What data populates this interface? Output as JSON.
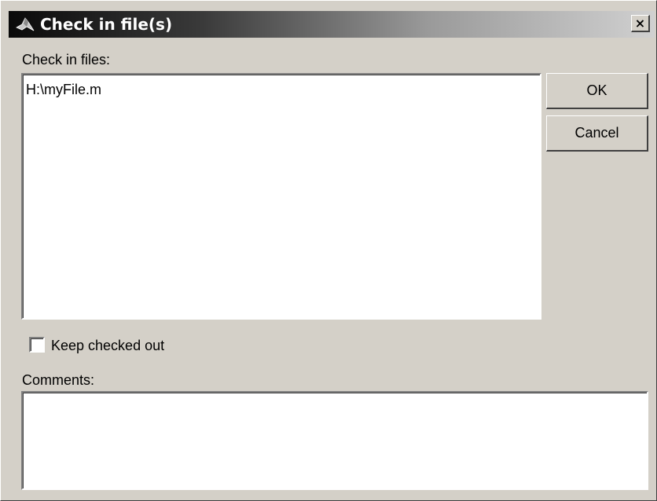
{
  "window": {
    "title": "Check in file(s)",
    "close_glyph": "×",
    "icon": "matlab-logo-icon"
  },
  "files_section": {
    "label": "Check in files:",
    "files": [
      "H:\\myFile.m"
    ]
  },
  "buttons": {
    "ok_label": "OK",
    "cancel_label": "Cancel"
  },
  "keep_checked_out": {
    "label": "Keep checked out",
    "checked": false
  },
  "comments": {
    "label": "Comments:",
    "value": ""
  },
  "colors": {
    "dialog_background": "#d4d0c8",
    "field_background": "#ffffff",
    "title_text": "#ffffff"
  }
}
